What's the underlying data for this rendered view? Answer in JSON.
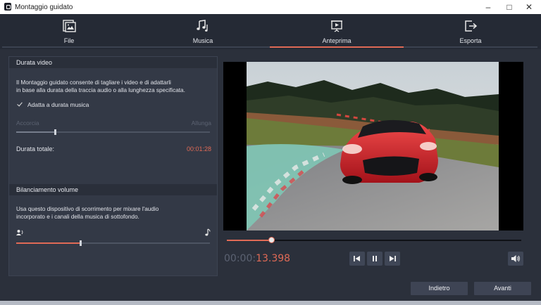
{
  "window": {
    "title": "Montaggio guidato"
  },
  "tabs": [
    {
      "label": "File",
      "icon": "file-image-icon",
      "active": false
    },
    {
      "label": "Musica",
      "icon": "music-notes-icon",
      "active": false
    },
    {
      "label": "Anteprima",
      "icon": "preview-play-icon",
      "active": true
    },
    {
      "label": "Esporta",
      "icon": "export-arrow-icon",
      "active": false
    }
  ],
  "video_duration": {
    "heading": "Durata video",
    "description_line1": "Il Montaggio guidato consente di tagliare i video e di adattarli",
    "description_line2": "in base alla durata della traccia audio o alla lunghezza specificata.",
    "fit_to_music_label": "Adatta a durata musica",
    "fit_to_music_checked": true,
    "shorten_label": "Accorcia",
    "lengthen_label": "Allunga",
    "slider_fraction": 0.2,
    "total_label": "Durata totale:",
    "total_value": "00:01:28"
  },
  "volume_balance": {
    "heading": "Bilanciamento volume",
    "description_line1": "Usa questo dispositivo di scorrimento per mixare l'audio",
    "description_line2": "incorporato e i canali della musica di sottofondo.",
    "slider_fraction": 0.33,
    "left_icon": "voice-icon",
    "right_icon": "music-note-icon"
  },
  "player": {
    "time_prefix": "00:00:",
    "time_current": "13.398",
    "progress_fraction": 0.15
  },
  "footer": {
    "back_label": "Indietro",
    "next_label": "Avanti"
  },
  "colors": {
    "accent": "#e06a56",
    "panel": "#333946",
    "background": "#2b303b"
  }
}
